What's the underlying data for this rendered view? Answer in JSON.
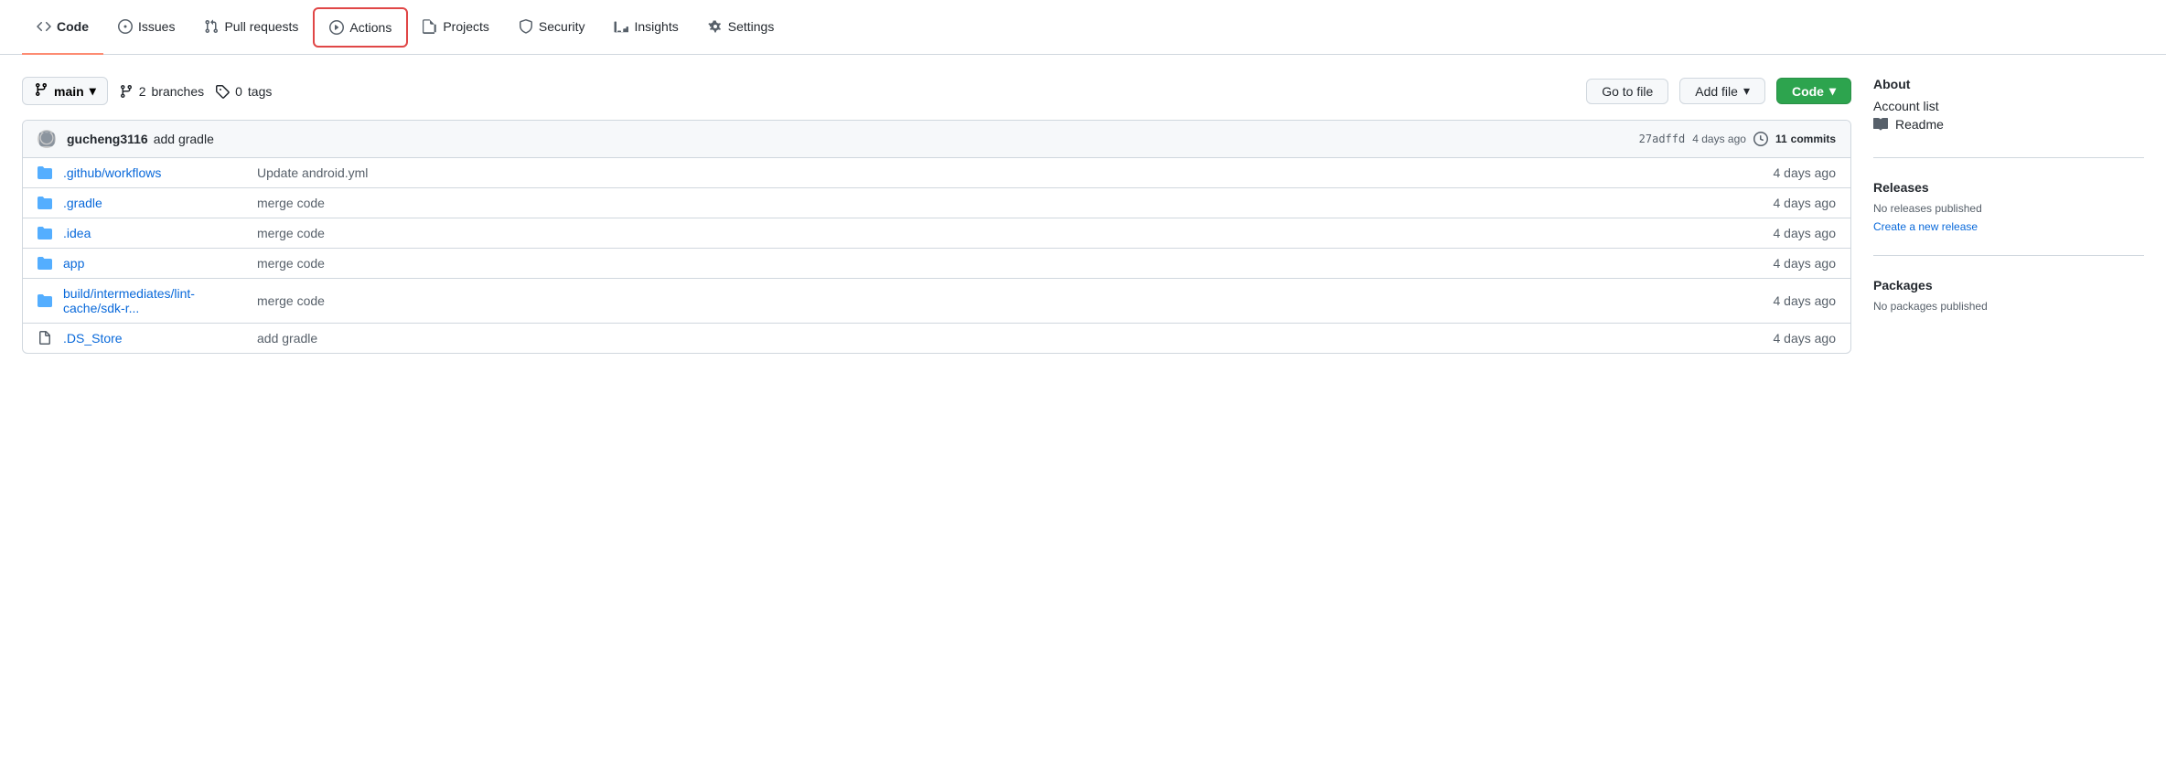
{
  "nav": {
    "items": [
      {
        "id": "code",
        "label": "Code",
        "icon": "code",
        "active": true,
        "highlighted": false
      },
      {
        "id": "issues",
        "label": "Issues",
        "icon": "circle",
        "active": false,
        "highlighted": false
      },
      {
        "id": "pull-requests",
        "label": "Pull requests",
        "icon": "git-merge",
        "active": false,
        "highlighted": false
      },
      {
        "id": "actions",
        "label": "Actions",
        "icon": "play-circle",
        "active": false,
        "highlighted": true
      },
      {
        "id": "projects",
        "label": "Projects",
        "icon": "table",
        "active": false,
        "highlighted": false
      },
      {
        "id": "security",
        "label": "Security",
        "icon": "shield",
        "active": false,
        "highlighted": false
      },
      {
        "id": "insights",
        "label": "Insights",
        "icon": "graph",
        "active": false,
        "highlighted": false
      },
      {
        "id": "settings",
        "label": "Settings",
        "icon": "gear",
        "active": false,
        "highlighted": false
      }
    ]
  },
  "branch": {
    "name": "main",
    "branches_count": "2",
    "branches_label": "branches",
    "tags_count": "0",
    "tags_label": "tags"
  },
  "toolbar": {
    "go_to_file": "Go to file",
    "add_file": "Add file",
    "code": "Code"
  },
  "commit": {
    "avatar_color": "#8b949e",
    "author": "gucheng3116",
    "message": "add gradle",
    "hash": "27adffd",
    "time": "4 days ago",
    "commits_count": "11",
    "commits_label": "commits"
  },
  "files": [
    {
      "type": "folder",
      "name": ".github/workflows",
      "commit": "Update android.yml",
      "time": "4 days ago"
    },
    {
      "type": "folder",
      "name": ".gradle",
      "commit": "merge code",
      "time": "4 days ago"
    },
    {
      "type": "folder",
      "name": ".idea",
      "commit": "merge code",
      "time": "4 days ago"
    },
    {
      "type": "folder",
      "name": "app",
      "commit": "merge code",
      "time": "4 days ago"
    },
    {
      "type": "folder",
      "name": "build/intermediates/lint-cache/sdk-r...",
      "commit": "merge code",
      "time": "4 days ago"
    },
    {
      "type": "file",
      "name": ".DS_Store",
      "commit": "add gradle",
      "time": "4 days ago"
    }
  ],
  "sidebar": {
    "about_title": "About",
    "account_list_label": "Account list",
    "readme_label": "Readme",
    "releases_title": "Releases",
    "no_releases": "No releases published",
    "create_release": "Create a new release",
    "packages_title": "Packages",
    "no_packages": "No packages published"
  }
}
